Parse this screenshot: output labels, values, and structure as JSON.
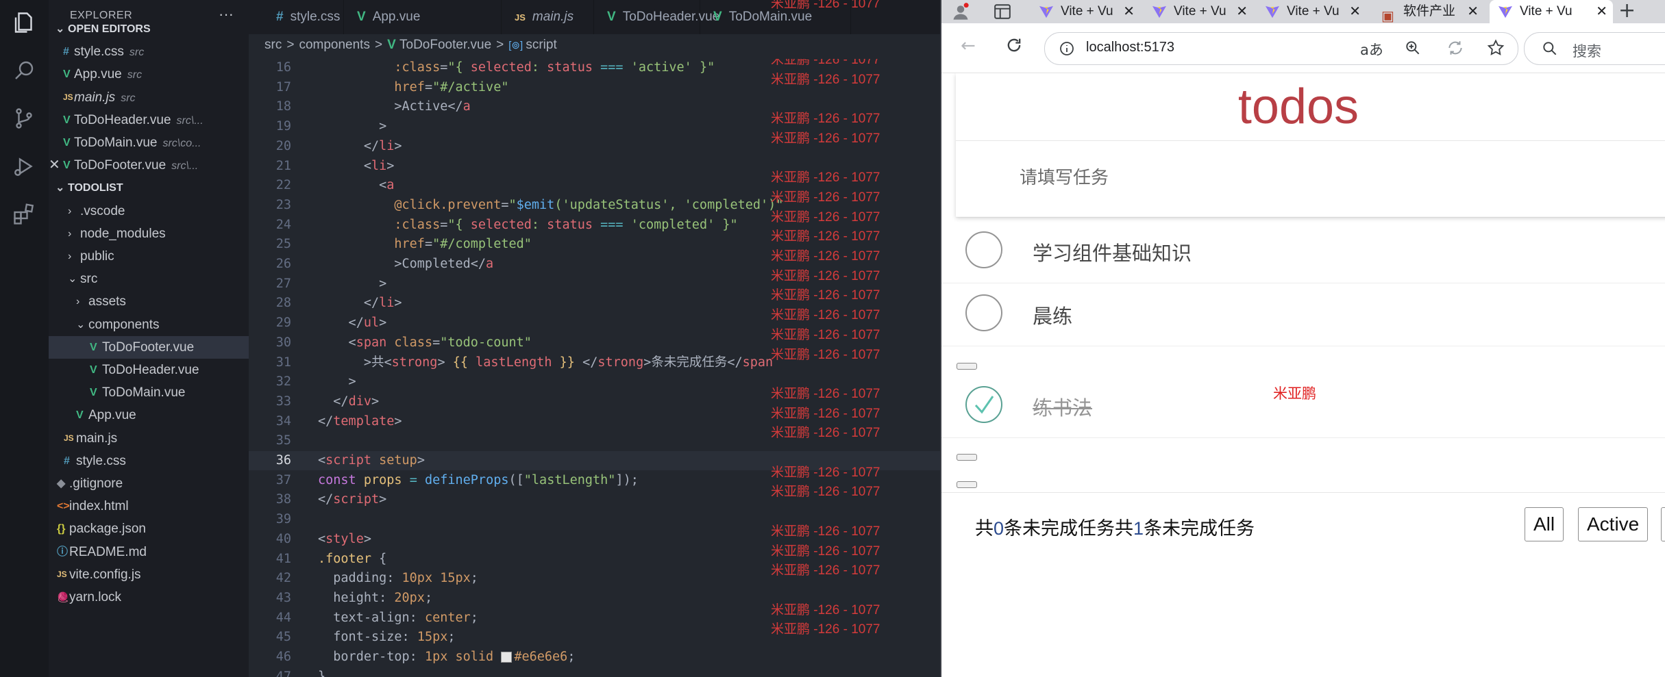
{
  "explorer": {
    "title": "EXPLORER",
    "more": "···",
    "open_editors_label": "OPEN EDITORS",
    "open_editors": [
      {
        "icon": "css",
        "name": "style.css",
        "desc": "src"
      },
      {
        "icon": "vue",
        "name": "App.vue",
        "desc": "src"
      },
      {
        "icon": "js",
        "name": "main.js",
        "desc": "src"
      },
      {
        "icon": "vue",
        "name": "ToDoHeader.vue",
        "desc": "src\\..."
      },
      {
        "icon": "vue",
        "name": "ToDoMain.vue",
        "desc": "src\\co..."
      },
      {
        "icon": "vue",
        "name": "ToDoFooter.vue",
        "desc": "src\\..."
      }
    ],
    "project_label": "TODOLIST",
    "tree": [
      {
        "chev": "›",
        "name": ".vscode"
      },
      {
        "chev": "›",
        "name": "node_modules"
      },
      {
        "chev": "›",
        "name": "public"
      },
      {
        "chev": "⌄",
        "name": "src"
      },
      {
        "chev": "›",
        "name": "assets"
      },
      {
        "chev": "⌄",
        "name": "components"
      },
      {
        "icon": "vue",
        "name": "ToDoFooter.vue"
      },
      {
        "icon": "vue",
        "name": "ToDoHeader.vue"
      },
      {
        "icon": "vue",
        "name": "ToDoMain.vue"
      },
      {
        "icon": "vue",
        "name": "App.vue"
      },
      {
        "icon": "js",
        "name": "main.js"
      },
      {
        "icon": "css",
        "name": "style.css"
      },
      {
        "icon": "git",
        "name": ".gitignore"
      },
      {
        "icon": "html",
        "name": "index.html"
      },
      {
        "icon": "json",
        "name": "package.json"
      },
      {
        "icon": "md",
        "name": "README.md"
      },
      {
        "icon": "js",
        "name": "vite.config.js"
      },
      {
        "icon": "yarn",
        "name": "yarn.lock"
      }
    ],
    "icon_glyphs": {
      "css": "#",
      "vue": "V",
      "js": "JS",
      "html": "<>",
      "json": "{}",
      "md": "ⓘ",
      "git": "◆",
      "yarn": "🧶"
    }
  },
  "editor": {
    "tabs": [
      {
        "icon": "css",
        "name": "style.css"
      },
      {
        "icon": "vue",
        "name": "App.vue"
      },
      {
        "icon": "js",
        "name": "main.js"
      },
      {
        "icon": "vue",
        "name": "ToDoHeader.vue"
      },
      {
        "icon": "vue",
        "name": "ToDoMain.vue"
      }
    ],
    "breadcrumb": {
      "parts": [
        "src",
        "components",
        "ToDoFooter.vue",
        "script"
      ],
      "sep": ">"
    },
    "watermark": "米亚鹏 -126 - 1077",
    "top_watermark": "米亚鹏 -126 - 1077",
    "current_line": 36,
    "lines": [
      {
        "n": 16,
        "html": "          <span class=\"t-attr\">:class</span>=<span class=\"t-str\">\"{ </span><span class=\"t-prop\">selected</span><span class=\"t-str\">: </span><span class=\"t-prop\">status</span> <span class=\"t-op\">===</span> <span class=\"t-str\">'active' }\"</span>"
      },
      {
        "n": 17,
        "html": "          <span class=\"t-attr\">href</span>=<span class=\"t-str\">\"#/active\"</span>"
      },
      {
        "n": 18,
        "html": "          &gt;Active&lt;/<span class=\"t-tag\">a</span>"
      },
      {
        "n": 19,
        "html": "        &gt;"
      },
      {
        "n": 20,
        "html": "      &lt;/<span class=\"t-tag\">li</span>&gt;"
      },
      {
        "n": 21,
        "html": "      &lt;<span class=\"t-tag\">li</span>&gt;"
      },
      {
        "n": 22,
        "html": "        &lt;<span class=\"t-tag\">a</span>"
      },
      {
        "n": 23,
        "html": "          <span class=\"t-attr\">@click.prevent</span>=<span class=\"t-str\">\"</span><span class=\"t-fn\">$emit</span><span class=\"t-str\">('updateStatus', 'completed')\"</span>"
      },
      {
        "n": 24,
        "html": "          <span class=\"t-attr\">:class</span>=<span class=\"t-str\">\"{ </span><span class=\"t-prop\">selected</span><span class=\"t-str\">: </span><span class=\"t-prop\">status</span> <span class=\"t-op\">===</span> <span class=\"t-str\">'completed' }\"</span>"
      },
      {
        "n": 25,
        "html": "          <span class=\"t-attr\">href</span>=<span class=\"t-str\">\"#/completed\"</span>"
      },
      {
        "n": 26,
        "html": "          &gt;Completed&lt;/<span class=\"t-tag\">a</span>"
      },
      {
        "n": 27,
        "html": "        &gt;"
      },
      {
        "n": 28,
        "html": "      &lt;/<span class=\"t-tag\">li</span>&gt;"
      },
      {
        "n": 29,
        "html": "    &lt;/<span class=\"t-tag\">ul</span>&gt;"
      },
      {
        "n": 30,
        "html": "    &lt;<span class=\"t-tag\">span</span> <span class=\"t-attr\">class</span>=<span class=\"t-str\">\"todo-count\"</span>"
      },
      {
        "n": 31,
        "html": "      &gt;共&lt;<span class=\"t-tag\">strong</span>&gt; <span class=\"t-var\">{{ </span><span class=\"t-prop\">lastLength</span><span class=\"t-var\"> }}</span> &lt;/<span class=\"t-tag\">strong</span>&gt;条未完成任务&lt;/<span class=\"t-tag\">span</span>"
      },
      {
        "n": 32,
        "html": "    &gt;"
      },
      {
        "n": 33,
        "html": "  &lt;/<span class=\"t-tag\">div</span>&gt;"
      },
      {
        "n": 34,
        "html": "&lt;/<span class=\"t-tag\">template</span>&gt;"
      },
      {
        "n": 35,
        "html": ""
      },
      {
        "n": 36,
        "html": "&lt;<span class=\"t-tag\">script</span> <span class=\"t-attr\">setup</span>&gt;"
      },
      {
        "n": 37,
        "html": "<span class=\"t-kw\">const</span> <span class=\"t-var\">props</span> <span class=\"t-op\">=</span> <span class=\"t-fn\">defineProps</span>([<span class=\"t-str\">\"lastLength\"</span>]);"
      },
      {
        "n": 38,
        "html": "&lt;/<span class=\"t-tag\">script</span>&gt;"
      },
      {
        "n": 39,
        "html": ""
      },
      {
        "n": 40,
        "html": "&lt;<span class=\"t-tag\">style</span>&gt;"
      },
      {
        "n": 41,
        "html": "<span class=\"t-var\">.footer</span> {"
      },
      {
        "n": 42,
        "html": "  <span class=\"t-plain\">padding</span>: <span class=\"t-num\">10px 15px</span>;"
      },
      {
        "n": 43,
        "html": "  <span class=\"t-plain\">height</span>: <span class=\"t-num\">20px</span>;"
      },
      {
        "n": 44,
        "html": "  <span class=\"t-plain\">text-align</span>: <span class=\"t-num\">center</span>;"
      },
      {
        "n": 45,
        "html": "  <span class=\"t-plain\">font-size</span>: <span class=\"t-num\">15px</span>;"
      },
      {
        "n": 46,
        "html": "  <span class=\"t-plain\">border-top</span>: <span class=\"t-num\">1px solid</span> <span class=\"swatch\"></span><span class=\"t-num\">#e6e6e6</span>;"
      },
      {
        "n": 47,
        "html": "}"
      }
    ]
  },
  "browser": {
    "tabs": [
      {
        "kind": "vite",
        "title": "Vite + Vu"
      },
      {
        "kind": "vite",
        "title": "Vite + Vu"
      },
      {
        "kind": "vite",
        "title": "Vite + Vu"
      },
      {
        "kind": "doc",
        "title": "软件产业"
      },
      {
        "kind": "vite",
        "title": "Vite + Vu",
        "active": true
      }
    ],
    "new_tab": "+",
    "url": "localhost:5173",
    "search_placeholder": "搜索",
    "watermark": "米亚鹏",
    "app": {
      "title": "todos",
      "input_placeholder": "请填写任务",
      "items": [
        {
          "text": "学习组件基础知识",
          "done": false
        },
        {
          "text": "晨练",
          "done": false
        },
        {
          "text": "练书法",
          "done": true
        }
      ],
      "count_prefix": "共",
      "count_suffix": "条未完成任务",
      "count_values": [
        "0",
        "1"
      ],
      "filters": [
        "All",
        "Active"
      ]
    }
  }
}
